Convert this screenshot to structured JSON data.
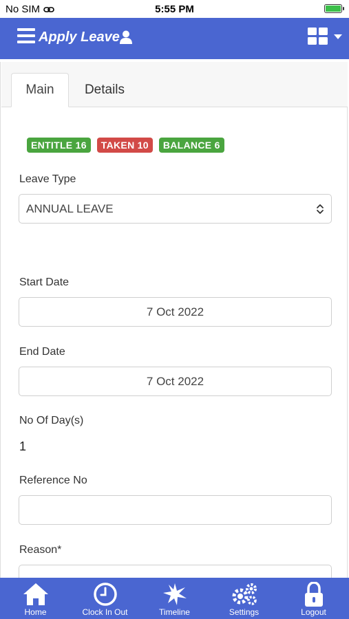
{
  "status_bar": {
    "carrier": "No SIM",
    "time": "5:55 PM"
  },
  "header": {
    "title": "Apply Leave"
  },
  "tabs": [
    {
      "label": "Main",
      "active": true
    },
    {
      "label": "Details",
      "active": false
    }
  ],
  "badges": [
    {
      "label": "ENTITLE 16",
      "color": "#4aa53f"
    },
    {
      "label": "TAKEN 10",
      "color": "#d24a47"
    },
    {
      "label": "BALANCE 6",
      "color": "#4aa53f"
    }
  ],
  "form": {
    "leave_type_label": "Leave Type",
    "leave_type_value": "ANNUAL LEAVE",
    "start_date_label": "Start Date",
    "start_date_value": "7 Oct 2022",
    "end_date_label": "End Date",
    "end_date_value": "7 Oct 2022",
    "days_label": "No Of Day(s)",
    "days_value": "1",
    "reference_label": "Reference No",
    "reference_value": "",
    "reason_label": "Reason*"
  },
  "bottom_nav": [
    {
      "label": "Home",
      "icon": "home-icon"
    },
    {
      "label": "Clock In Out",
      "icon": "clock-icon"
    },
    {
      "label": "Timeline",
      "icon": "timeline-icon"
    },
    {
      "label": "Settings",
      "icon": "gears-icon"
    },
    {
      "label": "Logout",
      "icon": "lock-icon"
    }
  ],
  "colors": {
    "primary": "#4a66d1",
    "success": "#4aa53f",
    "danger": "#d24a47"
  }
}
